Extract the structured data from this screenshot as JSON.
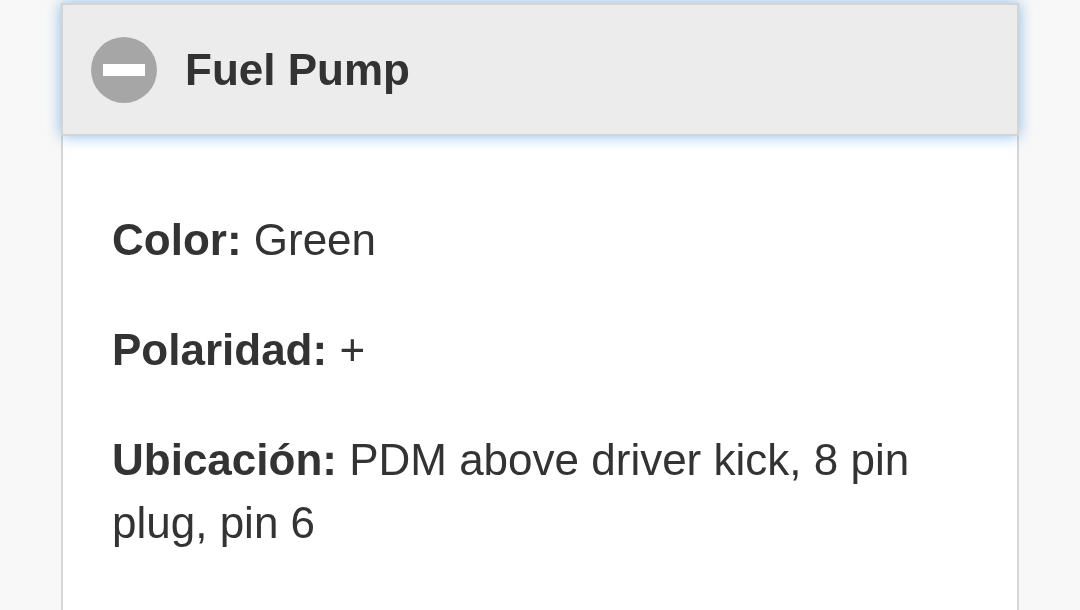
{
  "panel": {
    "title": "Fuel Pump",
    "expanded": true,
    "fields": [
      {
        "text": "**Color:** Green"
      },
      {
        "text": "**Polaridad:** +"
      },
      {
        "text": "**Ubicación:** PDM above driver kick, 8 pin plug, pin 6"
      }
    ]
  }
}
